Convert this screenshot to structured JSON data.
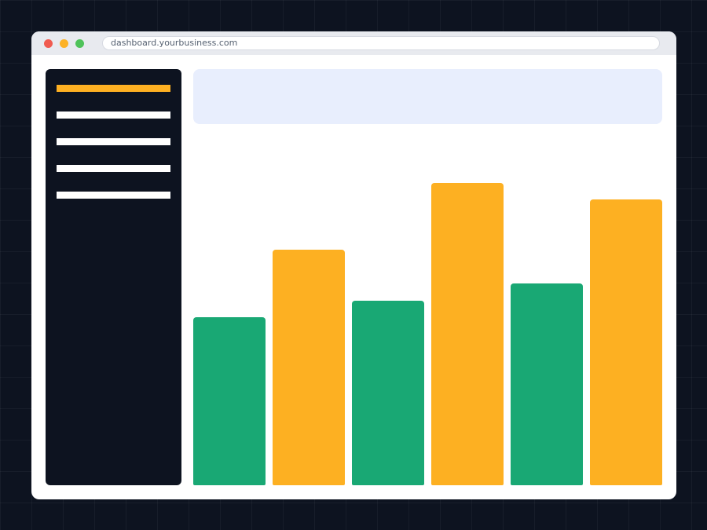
{
  "browser": {
    "url": "dashboard.yourbusiness.com"
  },
  "sidebar": {
    "items": [
      {
        "state": "active"
      },
      {
        "state": "inactive"
      },
      {
        "state": "inactive"
      },
      {
        "state": "inactive"
      },
      {
        "state": "inactive"
      }
    ]
  },
  "colors": {
    "background": "#0d1320",
    "window": "#ffffff",
    "titlebar": "#e8eaef",
    "sidebar": "#0d1320",
    "accent": "#fdb022",
    "header_panel": "#e8eefd",
    "green": "#19a874",
    "orange": "#fdb022"
  },
  "chart_data": {
    "type": "bar",
    "categories": [
      "",
      "",
      "",
      "",
      "",
      ""
    ],
    "values": [
      40,
      56,
      44,
      72,
      48,
      68
    ],
    "bar_colors": [
      "#19a874",
      "#fdb022",
      "#19a874",
      "#fdb022",
      "#19a874",
      "#fdb022"
    ],
    "ylim": [
      0,
      80
    ],
    "title": "",
    "xlabel": "",
    "ylabel": "",
    "grid": false,
    "legend": "none"
  }
}
